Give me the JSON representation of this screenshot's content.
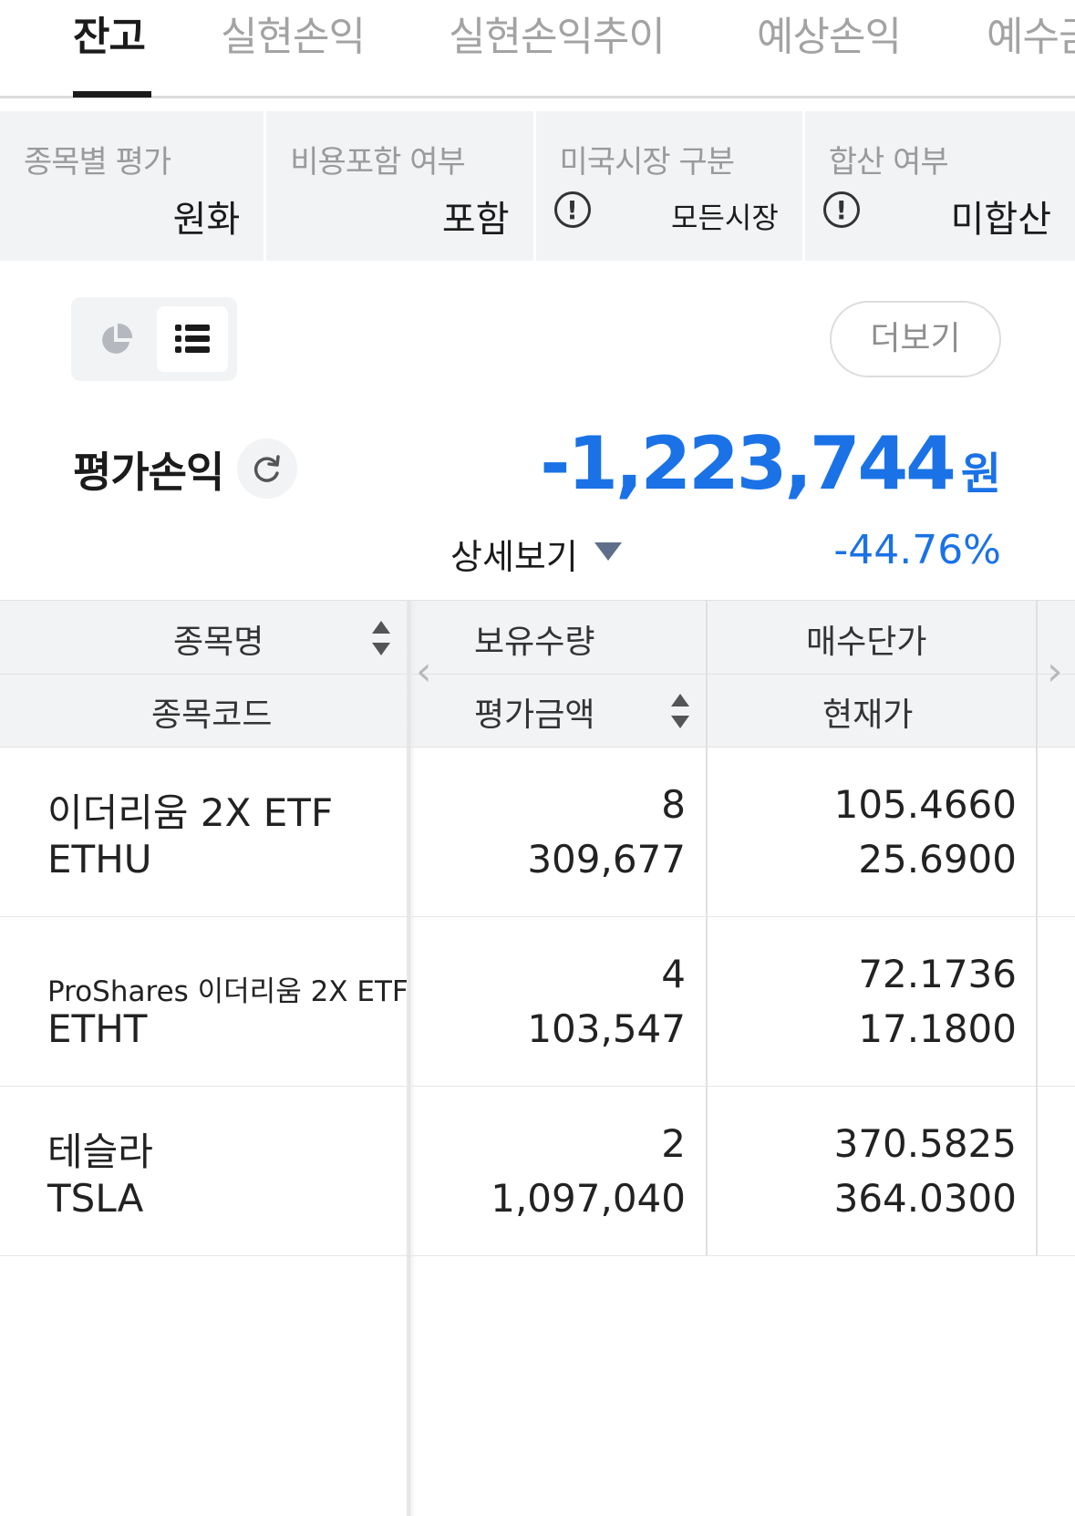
{
  "tabs": [
    "잔고",
    "실현손익",
    "실현손익추이",
    "예상손익",
    "예수금"
  ],
  "filters": [
    {
      "label": "종목별 평가",
      "value": "원화"
    },
    {
      "label": "비용포함 여부",
      "value": "포함"
    },
    {
      "label": "미국시장 구분",
      "value": "모든시장"
    },
    {
      "label": "합산 여부",
      "value": "미합산"
    }
  ],
  "view_toggle": {
    "options": [
      "pie-chart",
      "list"
    ],
    "active": "list"
  },
  "more_button": "더보기",
  "profit_loss": {
    "label": "평가손익",
    "amount": "-1,223,744",
    "unit": "원",
    "rate": "-44.76%",
    "detail_label": "상세보기"
  },
  "table": {
    "headers": {
      "name": "종목명",
      "code": "종목코드",
      "quantity": "보유수량",
      "eval_amount": "평가금액",
      "avg_price": "매수단가",
      "current_price": "현재가"
    },
    "rows": [
      {
        "name": "이더리움 2X ETF",
        "code": "ETHU",
        "quantity": "8",
        "eval_amount": "309,677",
        "avg_price": "105.4660",
        "current_price": "25.6900"
      },
      {
        "name": "ProShares 이더리움 2X ETF",
        "code": "ETHT",
        "quantity": "4",
        "eval_amount": "103,547",
        "avg_price": "72.1736",
        "current_price": "17.1800"
      },
      {
        "name": "테슬라",
        "code": "TSLA",
        "quantity": "2",
        "eval_amount": "1,097,040",
        "avg_price": "370.5825",
        "current_price": "364.0300"
      }
    ]
  },
  "colors": {
    "accent_blue": "#1a72e6",
    "panel_gray": "#f1f3f5"
  }
}
